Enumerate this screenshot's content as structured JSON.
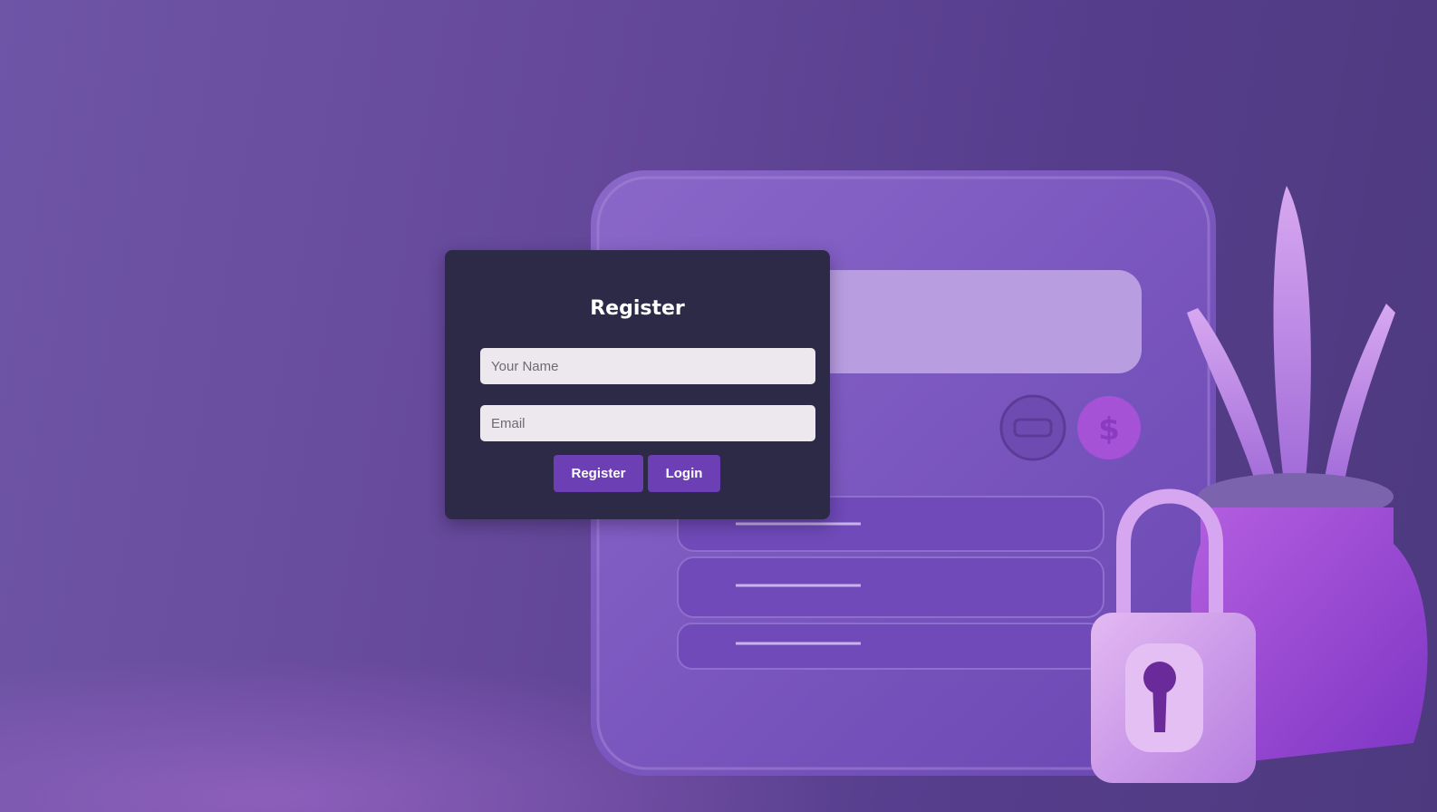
{
  "register_form": {
    "title": "Register",
    "name_field": {
      "placeholder": "Your Name",
      "value": ""
    },
    "email_field": {
      "placeholder": "Email",
      "value": ""
    },
    "register_button_label": "Register",
    "login_button_label": "Login"
  },
  "colors": {
    "card_background": "#2d2a48",
    "button": "#6c3fb4",
    "input_background": "#ece8ee",
    "page_background": "#66499b"
  },
  "background_illustration": {
    "icons": [
      "browser-window-icon",
      "padlock-icon",
      "plant-pot-icon",
      "dollar-coin-icon",
      "car-coin-icon"
    ]
  }
}
